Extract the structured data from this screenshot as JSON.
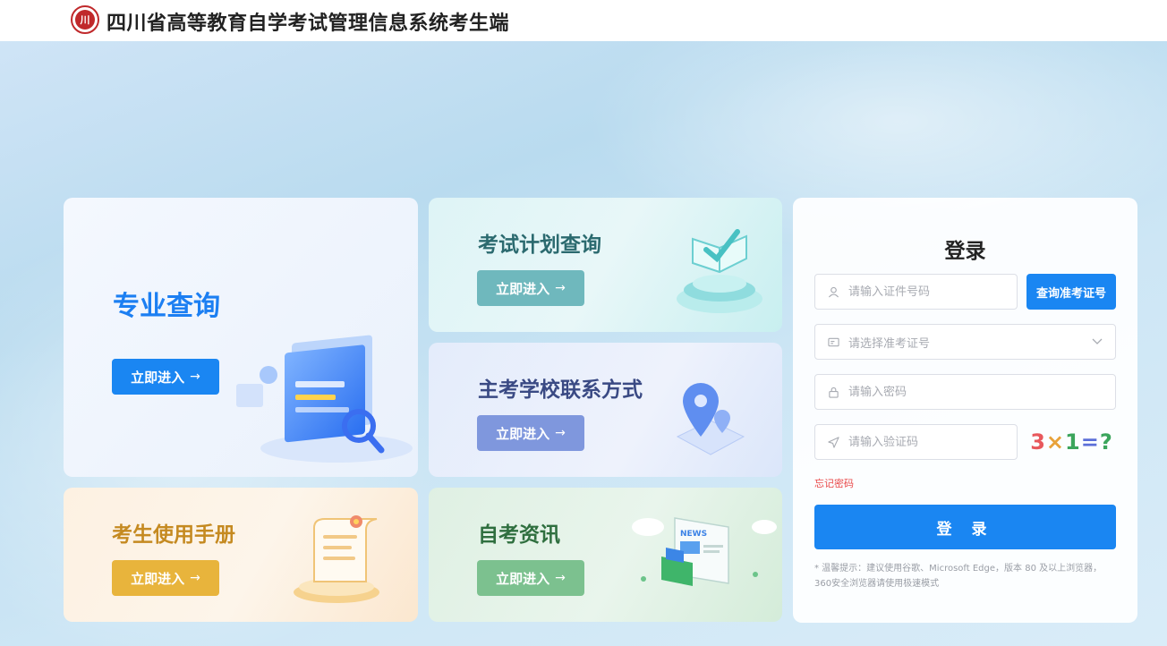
{
  "header": {
    "logo_text": "川",
    "title": "四川省高等教育自学考试管理信息系统考生端"
  },
  "cards": {
    "major": {
      "title": "专业查询",
      "button": "立即进入"
    },
    "plan": {
      "title": "考试计划查询",
      "button": "立即进入"
    },
    "school": {
      "title": "主考学校联系方式",
      "button": "立即进入"
    },
    "manual": {
      "title": "考生使用手册",
      "button": "立即进入"
    },
    "news": {
      "title": "自考资讯",
      "button": "立即进入",
      "news_label": "NEWS"
    }
  },
  "login": {
    "title": "登录",
    "id_placeholder": "请输入证件号码",
    "query_button": "查询准考证号",
    "exam_placeholder": "请选择准考证号",
    "password_placeholder": "请输入密码",
    "code_placeholder": "请输入验证码",
    "captcha": [
      "3",
      "×",
      "1",
      "=",
      "?"
    ],
    "forgot": "忘记密码",
    "submit": "登 录",
    "tip": "* 温馨提示：建议使用谷歌、Microsoft Edge，版本 80 及以上浏览器，360安全浏览器请使用极速模式"
  },
  "colors": {
    "primary": "#1a86f2",
    "plan": "#6fb8bd",
    "school": "#7f97dd",
    "manual": "#e8b43c",
    "news": "#7cc18f"
  }
}
